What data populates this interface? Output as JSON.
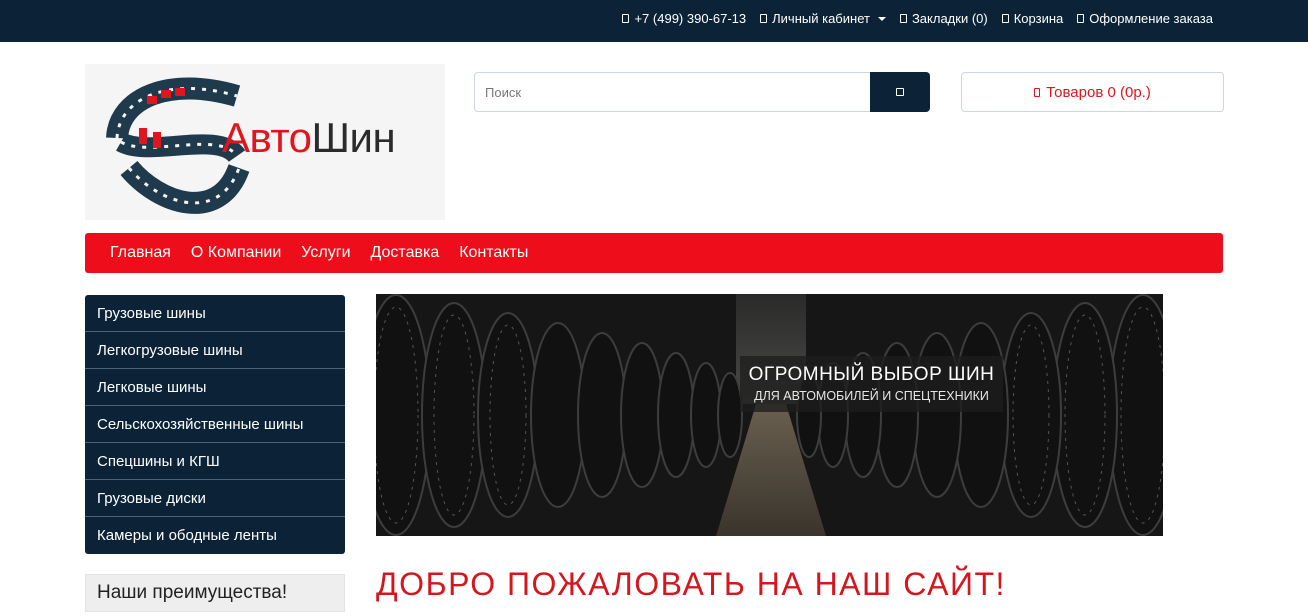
{
  "topbar": {
    "phone": "+7 (499) 390-67-13",
    "account": "Личный кабинет",
    "bookmarks": "Закладки (0)",
    "cart": "Корзина",
    "checkout": "Оформление заказа"
  },
  "logo": {
    "part1": "Авто",
    "part2": "Шин"
  },
  "search": {
    "placeholder": "Поиск"
  },
  "cart_button": {
    "label": "Товаров 0 (0р.)"
  },
  "menu": {
    "items": [
      "Главная",
      "О Компании",
      "Услуги",
      "Доставка",
      "Контакты"
    ]
  },
  "categories": [
    "Грузовые шины",
    "Легкогрузовые шины",
    "Легковые шины",
    "Сельскохозяйственные шины",
    "Спецшины и КГШ",
    "Грузовые диски",
    "Камеры и ободные ленты"
  ],
  "advantages": {
    "title": "Наши преимущества!"
  },
  "banner": {
    "headline": "ОГРОМНЫЙ ВЫБОР ШИН",
    "subline": "ДЛЯ АВТОМОБИЛЕЙ И СПЕЦТЕХНИКИ"
  },
  "welcome": {
    "title": "ДОБРО ПОЖАЛОВАТЬ НА НАШ САЙТ!"
  },
  "colors": {
    "navy": "#0c2337",
    "red": "#ee0d1a",
    "brand_red": "#e0151e"
  }
}
